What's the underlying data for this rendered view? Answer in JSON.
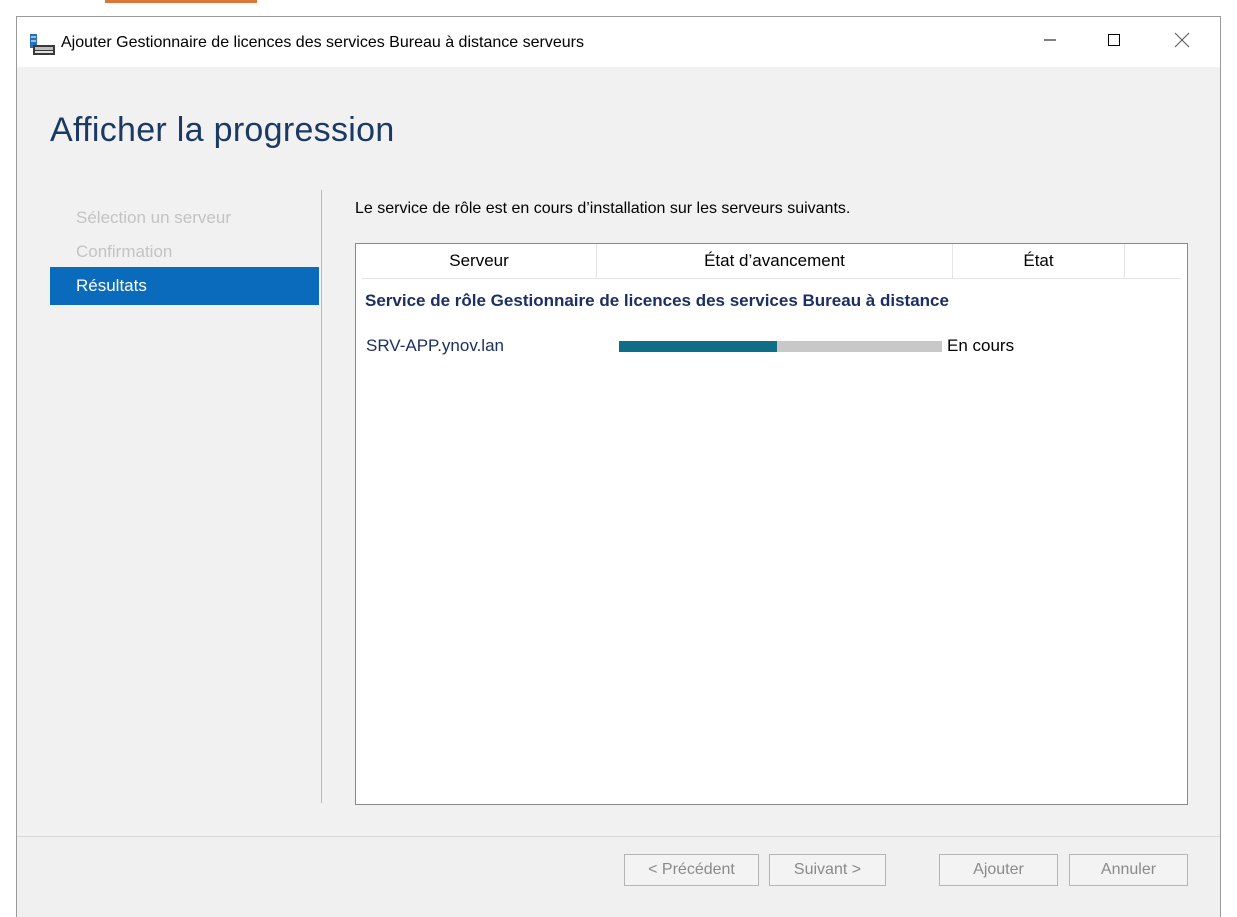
{
  "window": {
    "title": "Ajouter Gestionnaire de licences des services Bureau à distance serveurs",
    "icons": {
      "app": "server-role-icon",
      "minimize": "minimize-icon",
      "maximize": "maximize-icon",
      "close": "close-icon"
    }
  },
  "page": {
    "heading": "Afficher la progression",
    "description": "Le service de rôle est en cours d’installation sur les serveurs suivants."
  },
  "nav": {
    "items": [
      {
        "label": "Sélection un serveur",
        "active": false
      },
      {
        "label": "Confirmation",
        "active": false
      },
      {
        "label": "Résultats",
        "active": true
      }
    ]
  },
  "list": {
    "columns": [
      "Serveur",
      "État d’avancement",
      "État",
      ""
    ],
    "group_title": "Service de rôle Gestionnaire de licences des services Bureau à distance",
    "rows": [
      {
        "server": "SRV-APP.ynov.lan",
        "progress": 0.49,
        "status": "En cours"
      }
    ]
  },
  "footer": {
    "previous": "< Précédent",
    "next": "Suivant >",
    "add": "Ajouter",
    "cancel": "Annuler"
  },
  "colors": {
    "accent": "#0a6bbd",
    "progress_fill": "#0f6d86",
    "progress_track": "#c8c8c8",
    "heading": "#1a3a63",
    "group_text": "#1c2f63"
  }
}
